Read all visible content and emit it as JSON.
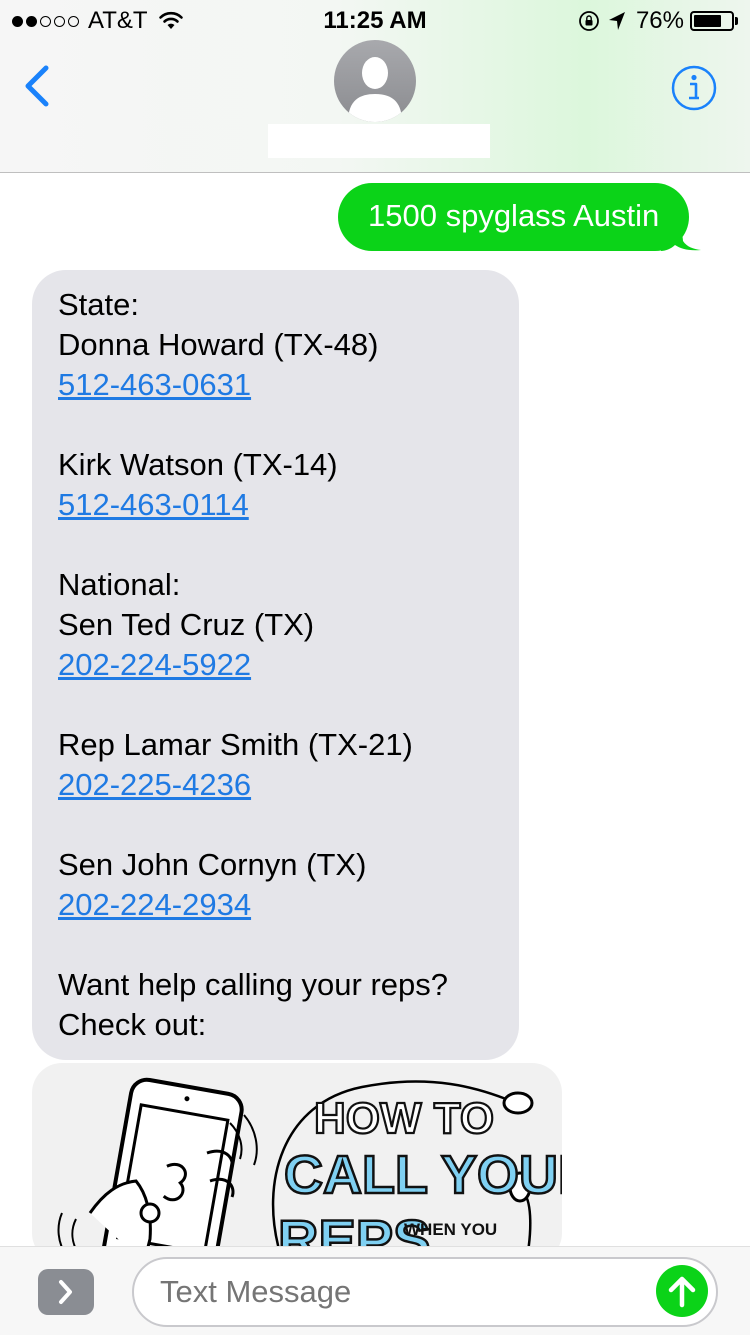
{
  "status_bar": {
    "signal_bars_filled": 2,
    "signal_bars_total": 5,
    "carrier": "AT&T",
    "time": "11:25 AM",
    "battery_percent_text": "76%",
    "battery_level": 0.76
  },
  "header": {
    "contact_name": ""
  },
  "messages": {
    "outgoing_text": "1500 spyglass Austin",
    "incoming": {
      "state_heading": "State:",
      "rep1_name": "Donna Howard (TX-48)",
      "rep1_phone": "512-463-0631",
      "rep2_name": "Kirk Watson (TX-14)",
      "rep2_phone": "512-463-0114",
      "national_heading": "National:",
      "rep3_name": "Sen Ted Cruz (TX)",
      "rep3_phone": "202-224-5922",
      "rep4_name": "Rep Lamar Smith (TX-21)",
      "rep4_phone": "202-225-4236",
      "rep5_name": "Sen John Cornyn (TX)",
      "rep5_phone": "202-224-2934",
      "closing_line1": "Want help calling your reps?",
      "closing_line2": "Check out:"
    },
    "link_preview": {
      "title_line1": "HOW TO",
      "title_line2": "CALL YOUR",
      "title_line3": "REPS",
      "side_text": "WHEN YOU"
    }
  },
  "input_bar": {
    "placeholder": "Text Message"
  },
  "colors": {
    "outgoing_bubble": "#0bd318",
    "incoming_bubble": "#e5e5ea",
    "link": "#1f7ae3",
    "ios_blue": "#1a82fb"
  }
}
